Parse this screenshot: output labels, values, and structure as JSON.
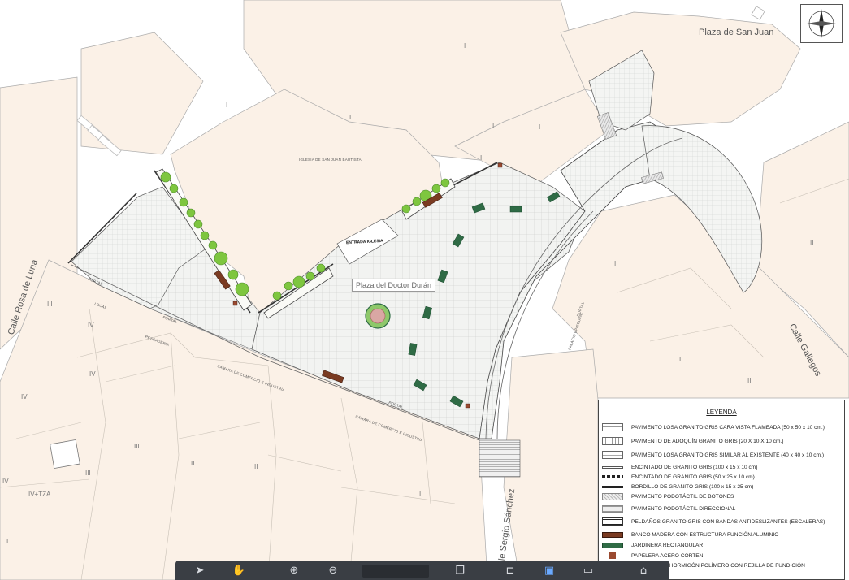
{
  "streets": {
    "plaza_san_juan": "Plaza de San Juan",
    "calle_rosa_de_luna": "Calle Rosa de Luna",
    "calle_gallegos": "Calle Gallegos",
    "calle_sergio_sanchez": "Calle Sergio Sánchez"
  },
  "buildings": {
    "iglesia": "IGLESIA DE SAN JUAN BAUTISTA",
    "entrada": "ENTRADA IGLESIA",
    "plaza": "Plaza del Doctor Durán",
    "local": "LOCAL",
    "pescaderia": "PESCADERIA",
    "camara1": "CÁMARA DE COMERCIO E INDUSTRIA",
    "camara2": "CÁMARA DE COMERCIO E INDUSTRIA",
    "palacio": "PALACIO EPISCOPAL",
    "portal1": "PORTAL",
    "portal2": "PORTAL",
    "portal3": "PORTAL",
    "portal4": "PORTAL",
    "tza": "IV+TZA"
  },
  "floors": {
    "f1": "I",
    "f2": "I",
    "f3": "I",
    "f4": "I",
    "f5": "I",
    "f6": "I",
    "f7": "I",
    "f8": "II",
    "f9": "II",
    "f10": "III",
    "f11": "III",
    "f12": "III",
    "f13": "IV",
    "f14": "IV",
    "f15": "IV",
    "f16": "IV",
    "f17": "II",
    "f18": "II",
    "f19": "II",
    "f20": "II",
    "f21": "I"
  },
  "legend": {
    "title": "LEYENDA",
    "items": [
      "PAVIMENTO LOSA GRANITO GRIS CARA VISTA FLAMEADA (50 x 50 x 10 cm.)",
      "PAVIMENTO DE ADOQUÍN GRANITO GRIS (20 X 10 X 10 cm.)",
      "PAVIMENTO LOSA GRANITO GRIS SIMILAR AL EXISTENTE (40 x 40 x 10 cm.)",
      "ENCINTADO DE GRANITO GRIS (100 x 15 x 10 cm)",
      "ENCINTADO DE GRANITO GRIS (50 x 25 x 10 cm)",
      "BORDILLO DE GRANITO GRIS (100 x 15 x 25 cm)",
      "PAVIMENTO PODOTÁCTIL DE BOTONES",
      "PAVIMENTO PODOTÁCTIL DIRECCIONAL",
      "PELDAÑOS GRANITO GRIS CON BANDAS ANTIDESLIZANTES (ESCALERAS)",
      "BANCO MADERA CON ESTRUCTURA FUNCIÓN ALUMINIO",
      "JARDINERA RECTANGULAR",
      "PAPELERA ACERO CORTEN",
      "CANALETA DE HORMIGÓN POLÍMERO CON REJILLA DE FUNDICIÓN"
    ]
  },
  "colors": {
    "building": "#fbf1e7",
    "paving": "#f4f5f3",
    "jardinera": "#2f6b45",
    "banco": "#7a3b22",
    "papelera": "#9a4a30",
    "tree": "#7ec63f",
    "toolbar": "#3a3e44"
  },
  "toolbar": {
    "icons": [
      "pointer-icon",
      "hand-icon",
      "zoom-in-icon",
      "zoom-out-icon",
      "page-icon",
      "copy-icon",
      "fit-icon",
      "bookmark-icon",
      "image-icon",
      "attach-icon"
    ]
  }
}
